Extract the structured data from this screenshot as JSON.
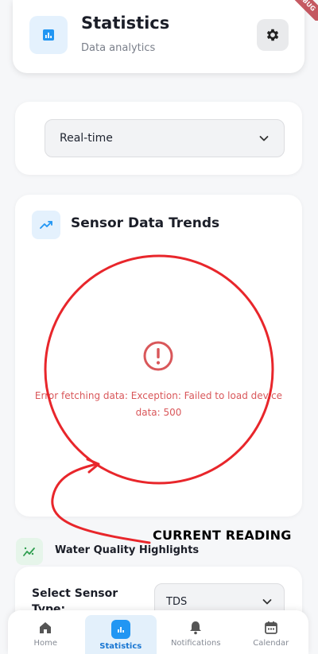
{
  "header": {
    "title": "Statistics",
    "subtitle": "Data analytics",
    "title_icon": "bar-chart-icon",
    "settings_icon": "gear-icon",
    "debug_banner": "DEBUG"
  },
  "time_range": {
    "selected": "Real-time",
    "icon": "chevron-down-icon"
  },
  "sensor_trends": {
    "title": "Sensor Data Trends",
    "icon": "trending-up-icon",
    "error_icon": "error-circle-icon",
    "error_message": "Error fetching data: Exception: Failed to load device data: 500"
  },
  "annotation": {
    "text": "CURRENT READING",
    "color": "#e8262b"
  },
  "water_quality": {
    "title": "Water Quality Highlights",
    "icon": "sparkle-chart-icon"
  },
  "sensor_select": {
    "label": "Select Sensor Type:",
    "value": "TDS",
    "icon": "chevron-down-icon"
  },
  "nav": {
    "items": [
      {
        "label": "Home",
        "icon": "home-icon",
        "active": false
      },
      {
        "label": "Statistics",
        "icon": "bar-chart-icon",
        "active": true
      },
      {
        "label": "Notifications",
        "icon": "bell-icon",
        "active": false
      },
      {
        "label": "Calendar",
        "icon": "calendar-icon",
        "active": false
      }
    ]
  },
  "colors": {
    "accent": "#2196f3",
    "error": "#d9575a",
    "background": "#f6f7f9"
  }
}
